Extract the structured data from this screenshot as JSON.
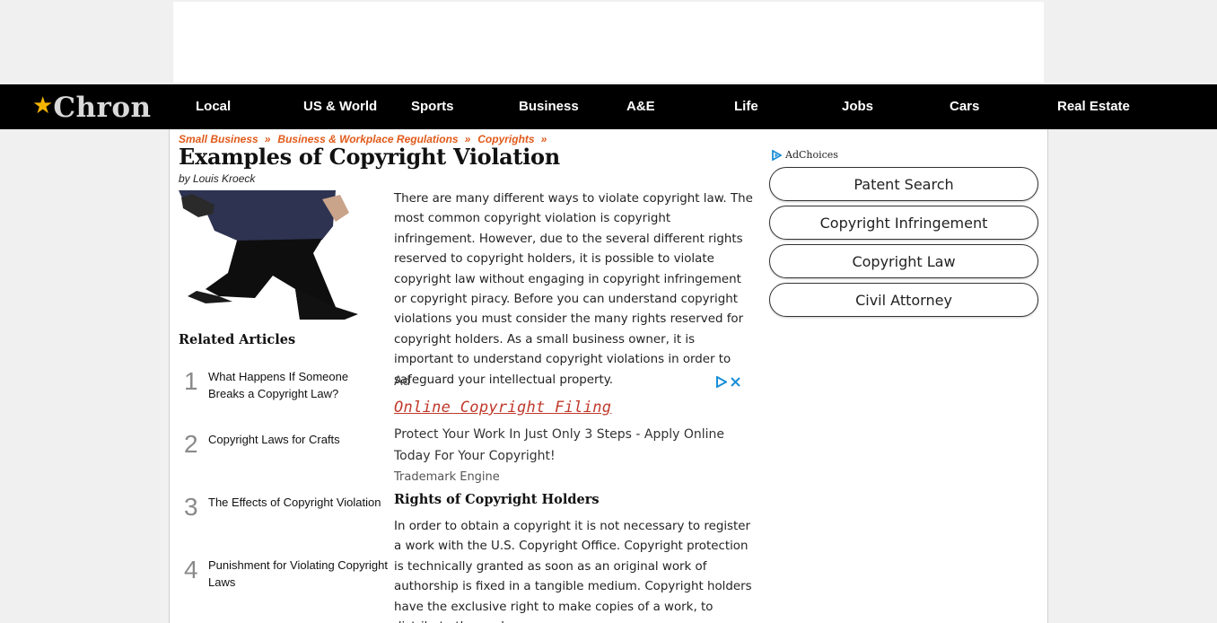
{
  "nav": {
    "logo_text": "Chron",
    "items": [
      "Local",
      "US & World",
      "Sports",
      "Business",
      "A&E",
      "Life",
      "Jobs",
      "Cars",
      "Real Estate"
    ]
  },
  "breadcrumb": {
    "items": [
      "Small Business",
      "Business & Workplace Regulations",
      "Copyrights"
    ],
    "separator": "»"
  },
  "article": {
    "title": "Examples of Copyright Violation",
    "byline": "by Louis Kroeck",
    "intro": "There are many different ways to violate copyright law. The most common copyright violation is copyright infringement. However, due to the several different rights reserved to copyright holders, it is possible to violate copyright law without engaging in copyright infringement or copyright piracy. Before you can understand copyright violations you must consider the many rights reserved for copyright holders. As a small business owner, it is important to understand copyright violations in order to safeguard your intellectual property.",
    "subhead": "Rights of Copyright Holders",
    "para2": "In order to obtain a copyright it is not necessary to register a work with the U.S. Copyright Office. Copyright protection is technically granted as soon as an original work of authorship is fixed in a tangible medium. Copyright holders have the exclusive right to make copies of a work, to distribute the work,"
  },
  "related": {
    "title": "Related Articles",
    "items": [
      {
        "num": "1",
        "text": "What Happens If Someone Breaks a Copyright Law?"
      },
      {
        "num": "2",
        "text": "Copyright Laws for Crafts"
      },
      {
        "num": "3",
        "text": "The Effects of Copyright Violation"
      },
      {
        "num": "4",
        "text": "Punishment for Violating Copyright Laws"
      }
    ]
  },
  "inline_ad": {
    "label": "Ad",
    "title": "Online Copyright Filing",
    "description": "Protect Your Work In Just Only 3 Steps - Apply Online Today For Your Copyright!",
    "source": "Trademark Engine"
  },
  "sidebar": {
    "adchoices": "AdChoices",
    "buttons": [
      "Patent Search",
      "Copyright Infringement",
      "Copyright Law",
      "Civil Attorney"
    ]
  },
  "colors": {
    "nav_bg": "#000000",
    "breadcrumb": "#e05a1a",
    "ad_title": "#c0392b",
    "logo_star": "#f5b400"
  }
}
